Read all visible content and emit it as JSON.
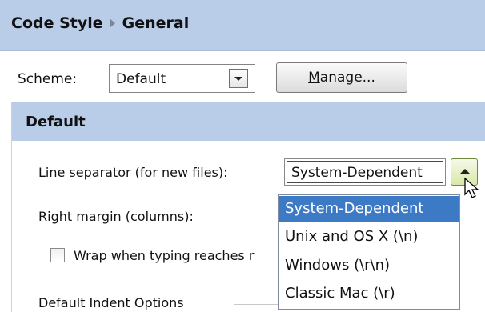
{
  "breadcrumb": {
    "parent": "Code Style",
    "current": "General"
  },
  "scheme": {
    "label": "Scheme:",
    "value": "Default",
    "manage_button": {
      "prefix": "",
      "mnemonic": "M",
      "rest": "anage..."
    }
  },
  "panel": {
    "title": "Default",
    "line_separator": {
      "label": "Line separator (for new files):",
      "value": "System-Dependent"
    },
    "right_margin": {
      "label": "Right margin (columns):"
    },
    "wrap_checkbox": {
      "label": "Wrap when typing reaches r",
      "checked": false
    },
    "indent_group": {
      "label": "Default Indent Options"
    }
  },
  "dropdown": {
    "options": [
      "System-Dependent",
      "Unix and OS X (\\n)",
      "Windows (\\r\\n)",
      "Classic Mac (\\r)"
    ],
    "selected_index": 0,
    "selected_color": "#3d7ac6"
  },
  "colors": {
    "header_bg": "#b9cde8",
    "arrow_active": "#d9e8a9"
  }
}
